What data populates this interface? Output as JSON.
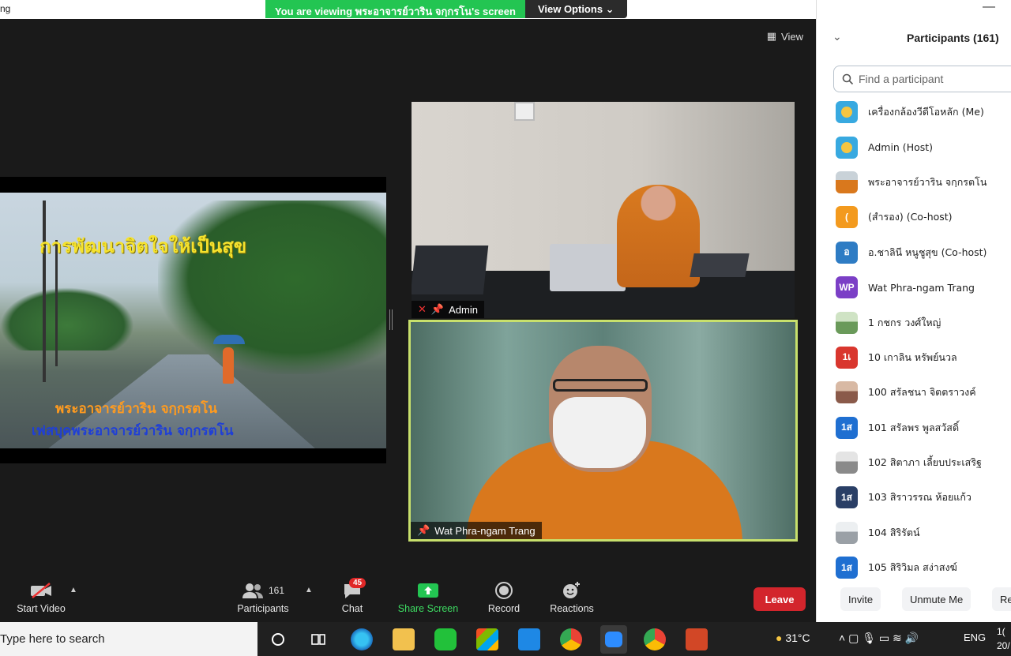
{
  "window": {
    "title_fragment": "ng"
  },
  "banner": {
    "viewing_text": "You are viewing พระอาจารย์วาริน จกฺกรโน's screen",
    "view_options": "View Options"
  },
  "stage": {
    "view_label": "View"
  },
  "share": {
    "title": "การพัฒนาจิตใจให้เป็นสุข",
    "line2": "พระอาจารย์วาริน จกฺกรตโน",
    "line3": "เฟสบุคพระอาจารย์วาริน จกฺกรตโน"
  },
  "videos": [
    {
      "name": "Admin"
    },
    {
      "name": "Wat Phra-ngam Trang"
    }
  ],
  "toolbar": {
    "start_video": "Start Video",
    "participants": "Participants",
    "participants_count": "161",
    "chat": "Chat",
    "chat_badge": "45",
    "share_screen": "Share Screen",
    "record": "Record",
    "reactions": "Reactions",
    "leave": "Leave"
  },
  "panel": {
    "title": "Participants (161)",
    "search_placeholder": "Find a participant",
    "participants": [
      {
        "name": "เครื่องกล้องวีดีโอหลัก (Me)",
        "avatar": "",
        "color": "#38a9e0"
      },
      {
        "name": "Admin (Host)",
        "avatar": "",
        "color": "#38a9e0"
      },
      {
        "name": "พระอาจารย์วาริน จกฺกรตโน",
        "avatar": "",
        "color": "#a0522d"
      },
      {
        "name": "(สำรอง) (Co-host)",
        "avatar": "(",
        "color": "#f39a1e"
      },
      {
        "name": "อ.ชาลินี หนูชูสุข (Co-host)",
        "avatar": "อ",
        "color": "#2e7cc4"
      },
      {
        "name": "Wat Phra-ngam Trang",
        "avatar": "WP",
        "color": "#7b3fc6"
      },
      {
        "name": "1 กชกร วงศ์ใหญ่",
        "avatar": "",
        "color": "#6a9a5a"
      },
      {
        "name": "10 เกาลิน หรัพย์นวล",
        "avatar": "1เ",
        "color": "#d9362e"
      },
      {
        "name": "100 สรัลชนา จิตตราวงค์",
        "avatar": "",
        "color": "#8a5a4a"
      },
      {
        "name": "101 สรัลพร พูลสวัสดิ์",
        "avatar": "1ส",
        "color": "#1f6fd1"
      },
      {
        "name": "102 สิตาภา เลี้ยบประเสริฐ",
        "avatar": "",
        "color": "#8a8a8a"
      },
      {
        "name": "103 สิราวรรณ ห้อยแก้ว",
        "avatar": "1ส",
        "color": "#2a3f66"
      },
      {
        "name": "104 สิริรัตน์",
        "avatar": "",
        "color": "#9aa0a6"
      },
      {
        "name": "105 สิริวิมล สง่าสงฆ์",
        "avatar": "1ส",
        "color": "#1f6fd1"
      }
    ],
    "invite": "Invite",
    "unmute_me": "Unmute Me",
    "more_cut": "Re"
  },
  "taskbar": {
    "search_placeholder": "Type here to search",
    "temperature": "31°C",
    "language": "ENG",
    "clock_cut": "1(",
    "date_cut": "20/"
  }
}
